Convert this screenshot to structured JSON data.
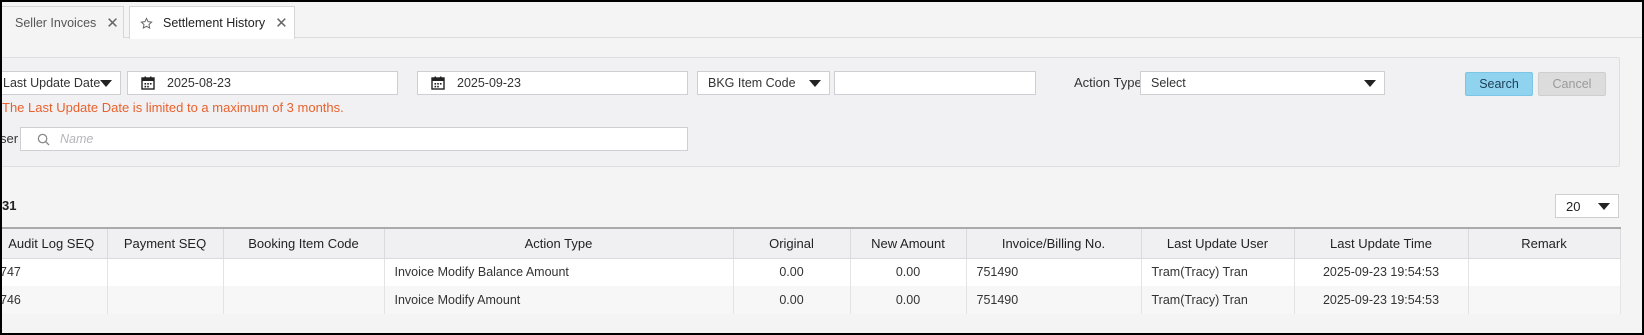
{
  "tabs": [
    {
      "label": "Seller Invoices",
      "active": false
    },
    {
      "label": "Settlement History",
      "active": true
    }
  ],
  "filters": {
    "date_type": "Last Update Date",
    "date_from": "2025-08-23",
    "date_sep": "~",
    "date_to": "2025-09-23",
    "code_type": "BKG Item Code",
    "code_value": "",
    "action_type_label": "Action Type",
    "action_type_value": "Select",
    "search_label": "Search",
    "cancel_label": "Cancel",
    "warning": "The Last Update Date is limited to a maximum of 3 months.",
    "user_label": "ser",
    "user_placeholder": "Name"
  },
  "results": {
    "count": "31",
    "page_size": "20"
  },
  "table": {
    "headers": [
      "Audit Log SEQ",
      "Payment SEQ",
      "Booking Item Code",
      "Action Type",
      "Original",
      "New Amount",
      "Invoice/Billing No.",
      "Last Update User",
      "Last Update Time",
      "Remark"
    ],
    "rows": [
      {
        "audit_seq": "747",
        "payment_seq": "",
        "booking_code": "",
        "action": "Invoice Modify Balance Amount",
        "original": "0.00",
        "new_amount": "0.00",
        "invoice_no": "751490",
        "user": "Tram(Tracy) Tran",
        "time": "2025-09-23 19:54:53",
        "remark": ""
      },
      {
        "audit_seq": "746",
        "payment_seq": "",
        "booking_code": "",
        "action": "Invoice Modify Amount",
        "original": "0.00",
        "new_amount": "0.00",
        "invoice_no": "751490",
        "user": "Tram(Tracy) Tran",
        "time": "2025-09-23 19:54:53",
        "remark": ""
      }
    ]
  },
  "colors": {
    "warning": "#e8622e",
    "search_button": "#8fd3ee",
    "cancel_button": "#dcdcdc"
  }
}
